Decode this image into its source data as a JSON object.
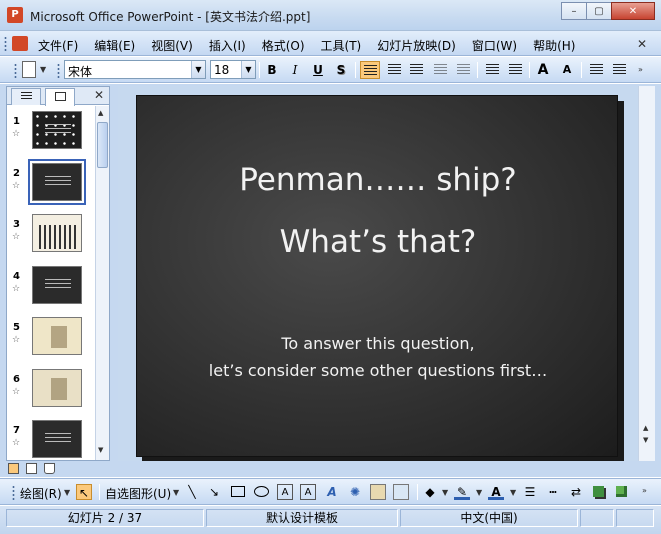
{
  "window": {
    "title": "Microsoft Office PowerPoint - [英文书法介绍.ppt]",
    "app_icon_glyph": "P",
    "minimize_glyph": "–",
    "maximize_glyph": "▢",
    "close_glyph": "✕"
  },
  "menu": {
    "items": [
      "文件(F)",
      "编辑(E)",
      "视图(V)",
      "插入(I)",
      "格式(O)",
      "工具(T)",
      "幻灯片放映(D)",
      "窗口(W)",
      "帮助(H)"
    ],
    "close_glyph": "✕"
  },
  "format_toolbar": {
    "font_name": "宋体",
    "font_size": "18",
    "bold": "B",
    "italic": "I",
    "underline": "U",
    "shadow": "S",
    "grow_font": "A",
    "shrink_font": "A"
  },
  "outline_panel": {
    "close_glyph": "✕",
    "slides": [
      {
        "number": "1",
        "theme": "dark-stars"
      },
      {
        "number": "2",
        "theme": "dark-text"
      },
      {
        "number": "3",
        "theme": "pens"
      },
      {
        "number": "4",
        "theme": "dark-text"
      },
      {
        "number": "5",
        "theme": "light-pen"
      },
      {
        "number": "6",
        "theme": "light-figure"
      },
      {
        "number": "7",
        "theme": "dark-text"
      }
    ],
    "selected_index": 1,
    "transition_glyph": "☆"
  },
  "slide": {
    "title_line1": "Penman…… ship?",
    "title_line2": "What’s that?",
    "body_line1": "To answer this question,",
    "body_line2": "let’s consider some other questions first…"
  },
  "drawing_toolbar": {
    "draw_label": "绘图(R)",
    "autoshapes_label": "自选图形(U)"
  },
  "status": {
    "slide_position": "幻灯片 2 / 37",
    "design_template": "默认设计模板",
    "language": "中文(中国)"
  },
  "colors": {
    "accent": "#d24726",
    "selection": "#fbc97c",
    "chrome": "#c5d8f0"
  }
}
